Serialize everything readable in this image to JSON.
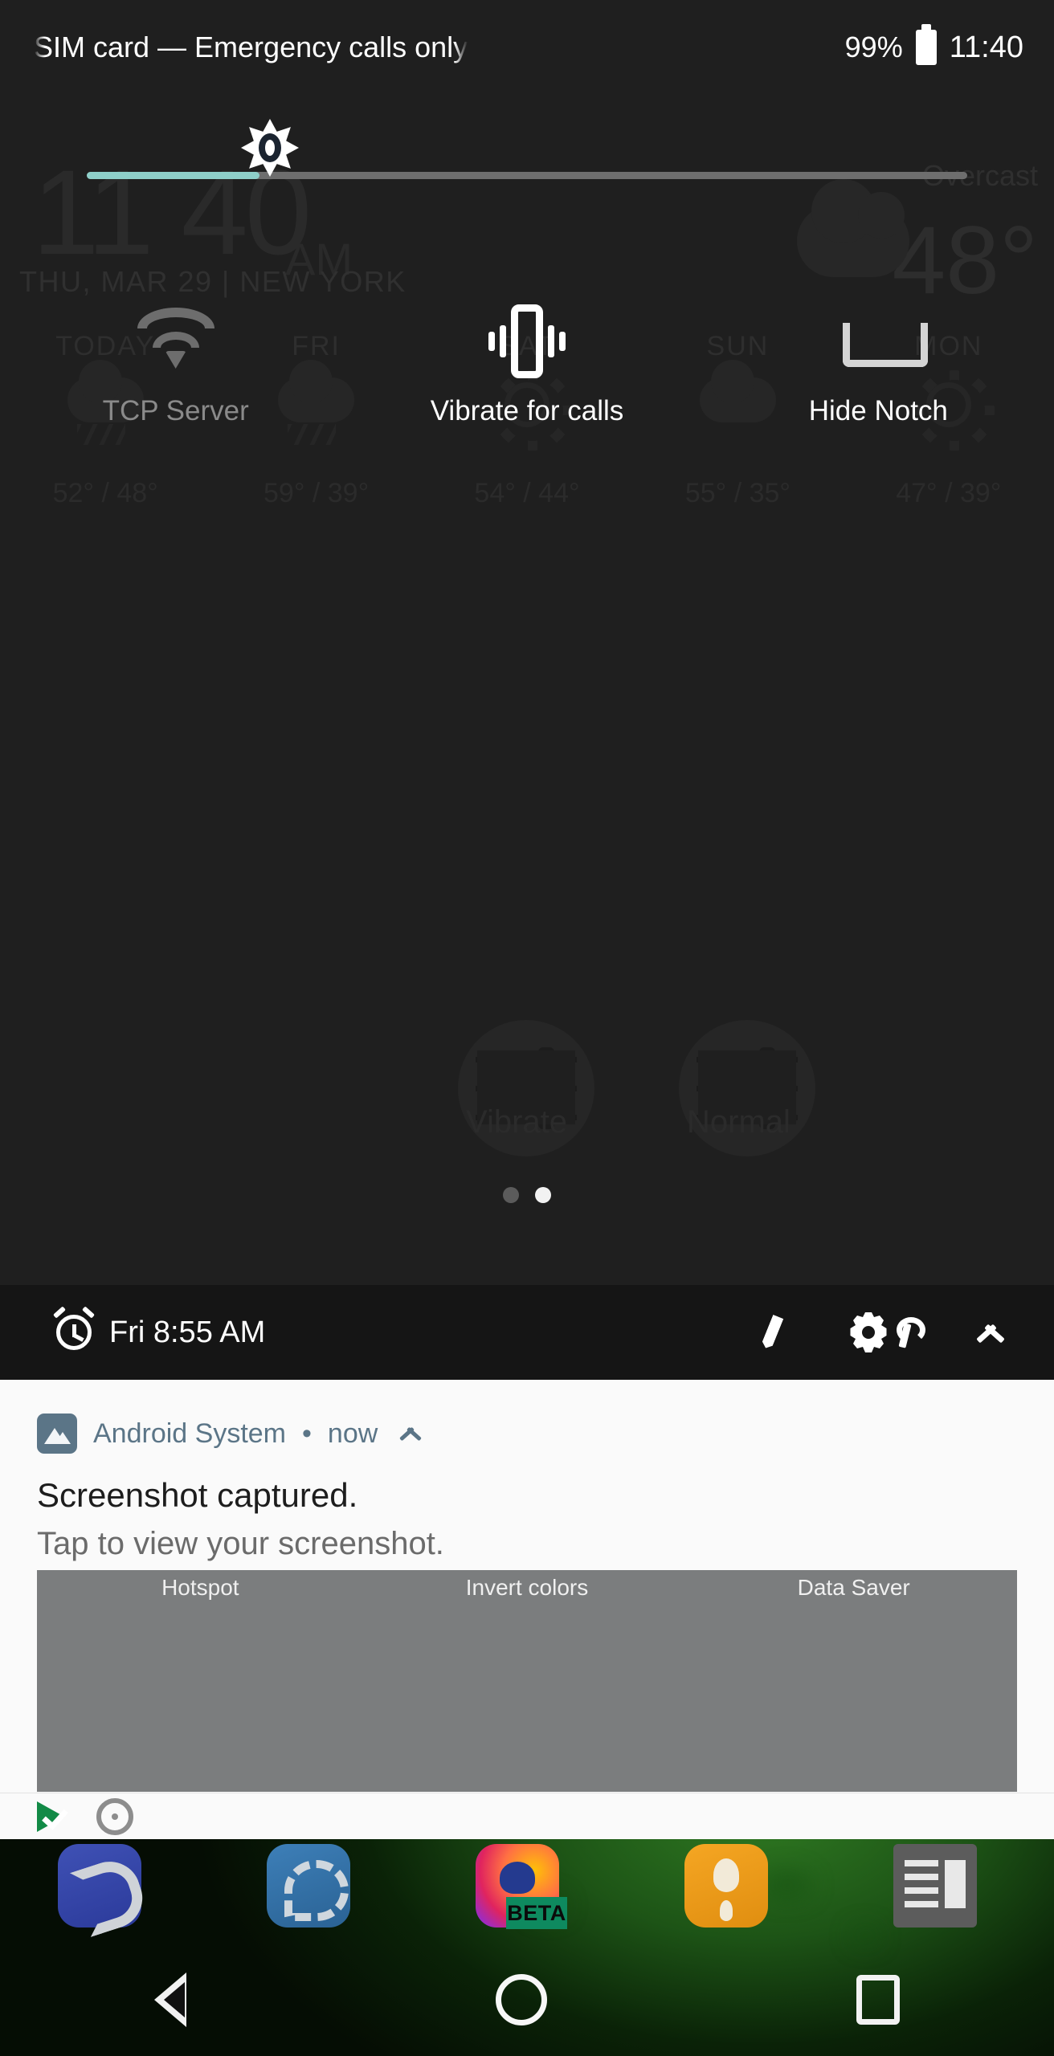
{
  "status_bar": {
    "carrier_text": "SIM card — Emergency calls only",
    "battery_percent": "99%",
    "clock": "11:40",
    "battery_icon": "battery-full-icon"
  },
  "brightness": {
    "icon": "brightness-sun-icon",
    "level_percent": 19
  },
  "quick_settings": {
    "tiles": [
      {
        "label": "TCP Server",
        "icon": "wifi-icon",
        "state": "inactive"
      },
      {
        "label": "Vibrate for calls",
        "icon": "vibrate-icon",
        "state": "active"
      },
      {
        "label": "Hide Notch",
        "icon": "notch-icon",
        "state": "active"
      }
    ],
    "page_dots": {
      "count": 2,
      "active_index": 1
    }
  },
  "qs_footer": {
    "alarm_icon": "alarm-clock-icon",
    "alarm_text": "Fri 8:55 AM",
    "edit_icon": "pencil-icon",
    "settings_icon": "gear-wrench-icon",
    "collapse_icon": "chevron-up-icon"
  },
  "notification": {
    "app_icon": "image-photo-icon",
    "app_name": "Android System",
    "separator": "•",
    "time": "now",
    "expand_icon": "chevron-up-icon",
    "title": "Screenshot captured.",
    "body": "Tap to view your screenshot.",
    "preview_labels": [
      "Hotspot",
      "Invert colors",
      "Data Saver"
    ],
    "preview_icon": "moon-icon"
  },
  "notification_icons": [
    {
      "name": "play-check-icon",
      "color": "#128a46"
    },
    {
      "name": "record-circle-icon",
      "color": "#8d8d8d"
    }
  ],
  "background_widget": {
    "clock_time": "11 40",
    "clock_hour": "11",
    "clock_minute": "40",
    "am_pm": "AM",
    "date_location": "THU, MAR 29 | NEW YORK",
    "condition": "Overcast",
    "temperature": "48°",
    "forecast_days": [
      "TODAY",
      "FRI",
      "SAT",
      "SUN",
      "MON"
    ],
    "forecast_temps": [
      "52° / 48°",
      "59° / 39°",
      "54° / 44°",
      "55° / 35°",
      "47° / 39°"
    ],
    "ghost_tiles": [
      "Vibrate",
      "Normal"
    ]
  },
  "dock_apps": [
    {
      "name": "phone-app-icon"
    },
    {
      "name": "messenger-app-icon"
    },
    {
      "name": "firefox-beta-app-icon",
      "badge": "BETA"
    },
    {
      "name": "lightbulb-app-icon"
    },
    {
      "name": "docs-app-icon"
    }
  ],
  "nav_bar": {
    "back": "back-triangle-icon",
    "home": "home-circle-icon",
    "recents": "recents-square-icon"
  },
  "colors": {
    "panel_bg": "#1f1f1f",
    "footer_bg": "#151515",
    "shade_bg": "#fafafa",
    "accent_teal": "#8ecfc9",
    "notif_accent": "#5b7587",
    "preview_bg": "#7b7d7e"
  }
}
